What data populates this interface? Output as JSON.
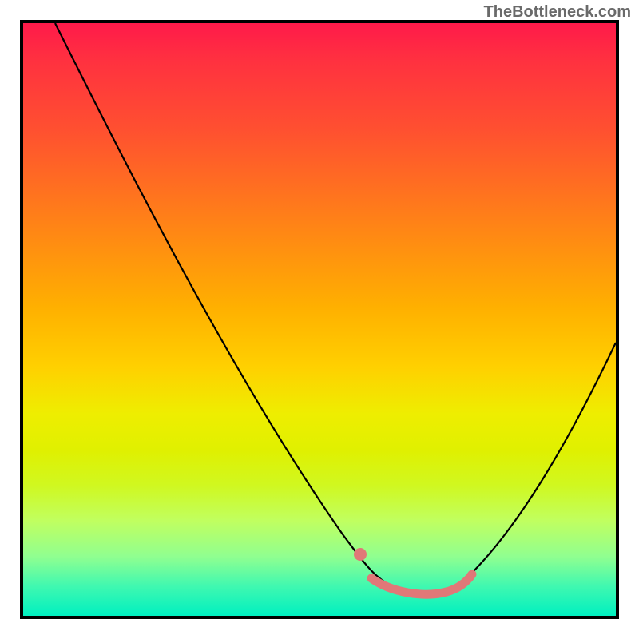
{
  "watermark": "TheBottleneck.com",
  "chart_data": {
    "type": "line",
    "title": "",
    "xlabel": "",
    "ylabel": "",
    "xlim": [
      0,
      100
    ],
    "ylim": [
      0,
      100
    ],
    "grid": false,
    "legend": false,
    "series": [
      {
        "name": "bottleneck-curve",
        "x": [
          0,
          5,
          10,
          15,
          20,
          25,
          30,
          35,
          40,
          45,
          50,
          55,
          57,
          60,
          62,
          65,
          68,
          70,
          73,
          76,
          80,
          85,
          90,
          95,
          100
        ],
        "values": [
          100,
          93,
          86,
          78,
          70,
          62,
          54,
          46,
          38,
          30,
          22,
          14,
          11,
          7,
          5,
          3,
          2,
          2,
          3,
          5,
          9,
          16,
          25,
          36,
          49
        ]
      }
    ],
    "annotations": [
      {
        "name": "optimal-dot",
        "x": 57,
        "y": 11
      },
      {
        "name": "optimal-range",
        "x_start": 59,
        "x_end": 74
      }
    ],
    "background_gradient": {
      "top": "#ff1a4a",
      "mid": "#ffd000",
      "bottom": "#00f0c0"
    }
  }
}
